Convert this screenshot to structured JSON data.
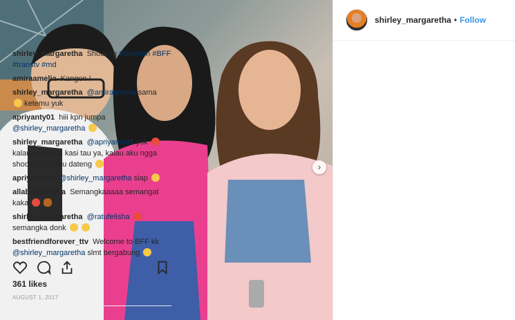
{
  "post": {
    "username": "shirley_margaretha",
    "separator": "•",
    "follow_label": "Follow",
    "likes": "361 likes",
    "date": "AUGUST 1, 2017"
  },
  "comments": [
    {
      "user": "shirley_margaretha",
      "text": "Shooting ",
      "tags": "#sinetron #BFF #transtv #md",
      "emoji": ""
    },
    {
      "user": "amiraamelia",
      "text": "Kangen !",
      "tags": "",
      "emoji": ""
    },
    {
      "user": "shirley_margaretha",
      "text": "",
      "tags": "@amiraamelia",
      "text2": " sama",
      "text3": "ketemu yuk",
      "emoji": "sad"
    },
    {
      "user": "apriyanty01",
      "text": "hiii kpn jumpa ",
      "tags": "@shirley_margaretha",
      "emoji": "grin"
    },
    {
      "user": "shirley_margaretha",
      "text": "",
      "tags": "@apriyanty01",
      "text2": " yuk",
      "text3": "kalau ke kocas kasi tau ya, kalau aku ngga shooting tar aku dateng",
      "emoji": "love"
    },
    {
      "user": "apriyanty01",
      "text": "",
      "tags": "@shirley_margaretha",
      "text2": " siap",
      "emoji": "wink"
    },
    {
      "user": "allaboutfelisha",
      "text": "Semangkaaaaa semangat kaka",
      "tags": "",
      "emoji": "melon"
    },
    {
      "user": "shirley_margaretha",
      "text": "",
      "tags": "@ratufelisha",
      "text3": "semangka donk",
      "emoji": "laugh"
    },
    {
      "user": "bestfriendforever_ttv",
      "text": "Welcome to BFF kk ",
      "tags": "@shirley_margaretha",
      "text2": " slmt bergabung",
      "emoji": "smile"
    }
  ],
  "icons": {
    "like": "heart-icon",
    "comment": "comment-icon",
    "share": "share-icon",
    "save": "bookmark-icon",
    "next": "chevron-right-icon"
  },
  "colors": {
    "link": "#3897f0",
    "tag": "#003569"
  }
}
